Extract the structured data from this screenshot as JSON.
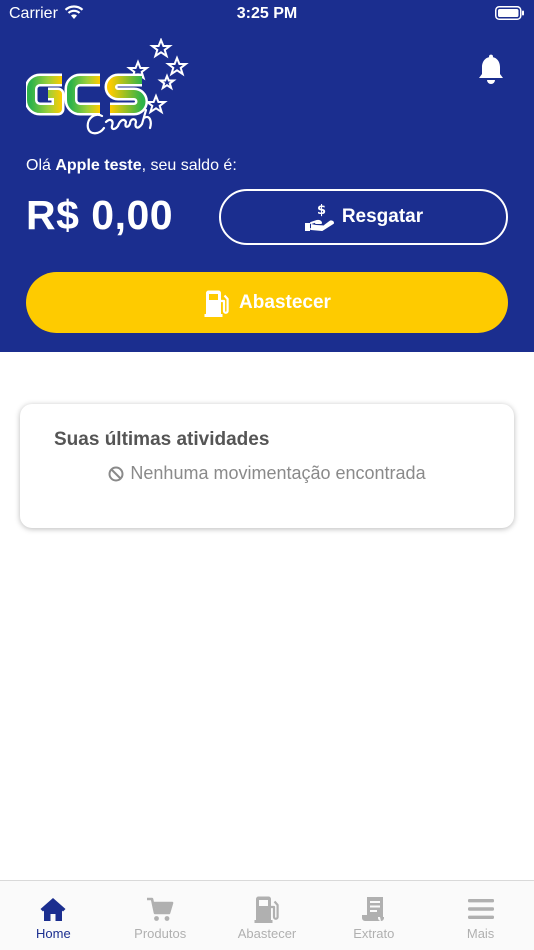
{
  "status_bar": {
    "carrier": "Carrier",
    "time": "3:25 PM"
  },
  "header": {
    "greeting_prefix": "Olá ",
    "user_name": "Apple teste",
    "greeting_suffix": ", seu saldo é:",
    "balance": "R$ 0,00",
    "resgatar_label": "Resgatar",
    "abastecer_label": "Abastecer"
  },
  "activity": {
    "title": "Suas últimas atividades",
    "empty_text": "Nenhuma movimentação encontrada"
  },
  "tabbar": {
    "items": [
      {
        "label": "Home",
        "icon": "home-icon",
        "active": true
      },
      {
        "label": "Produtos",
        "icon": "cart-icon",
        "active": false
      },
      {
        "label": "Abastecer",
        "icon": "fuel-pump-icon",
        "active": false
      },
      {
        "label": "Extrato",
        "icon": "receipt-icon",
        "active": false
      },
      {
        "label": "Mais",
        "icon": "menu-icon",
        "active": false
      }
    ]
  },
  "colors": {
    "brand_blue": "#1b2e8f",
    "brand_yellow": "#fecb00",
    "inactive_tab": "#b0b0b0"
  }
}
